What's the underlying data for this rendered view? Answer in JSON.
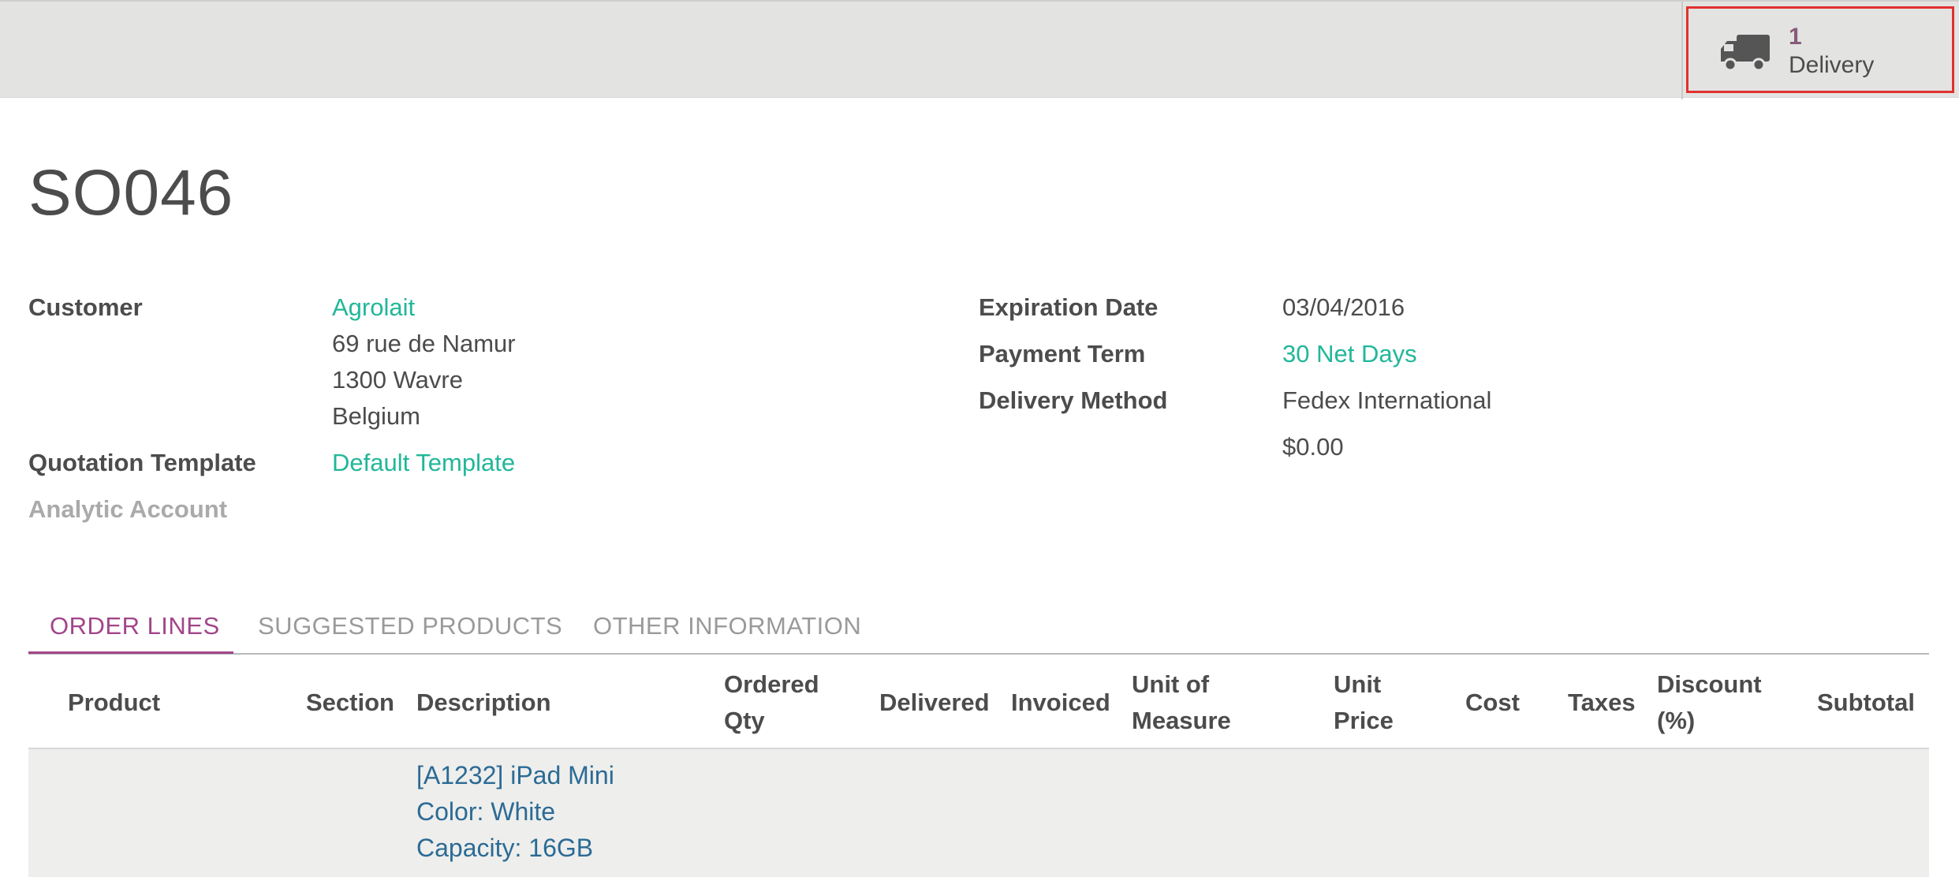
{
  "button_box": {
    "delivery": {
      "icon": "truck-icon",
      "count": "1",
      "label": "Delivery"
    }
  },
  "title": "SO046",
  "left_fields": {
    "customer_label": "Customer",
    "customer_name": "Agrolait",
    "address_line1": "69 rue de Namur",
    "address_line2": "1300 Wavre",
    "address_line3": "Belgium",
    "quotation_template_label": "Quotation Template",
    "quotation_template_value": "Default Template",
    "analytic_account_label": "Analytic Account"
  },
  "right_fields": {
    "expiration_date_label": "Expiration Date",
    "expiration_date_value": "03/04/2016",
    "payment_term_label": "Payment Term",
    "payment_term_value": "30 Net Days",
    "delivery_method_label": "Delivery Method",
    "delivery_method_value": "Fedex International",
    "delivery_price": "$0.00"
  },
  "tabs": [
    {
      "label": "ORDER LINES",
      "active": true
    },
    {
      "label": "SUGGESTED PRODUCTS",
      "active": false
    },
    {
      "label": "OTHER INFORMATION",
      "active": false
    }
  ],
  "table": {
    "columns": [
      "Product",
      "Section",
      "Description",
      "Ordered\nQty",
      "Delivered",
      "Invoiced",
      "Unit of\nMeasure",
      "Unit\nPrice",
      "Cost",
      "Taxes",
      "Discount\n(%)",
      "Subtotal"
    ],
    "rows": [
      {
        "description_lines": [
          "[A1232] iPad Mini",
          "Color: White",
          "Capacity: 16GB"
        ]
      }
    ]
  },
  "colors": {
    "accent": "#875a7b",
    "link": "#21b799",
    "tab_active": "#a24689",
    "row_link": "#2b6b95",
    "highlight": "#e0312f"
  }
}
